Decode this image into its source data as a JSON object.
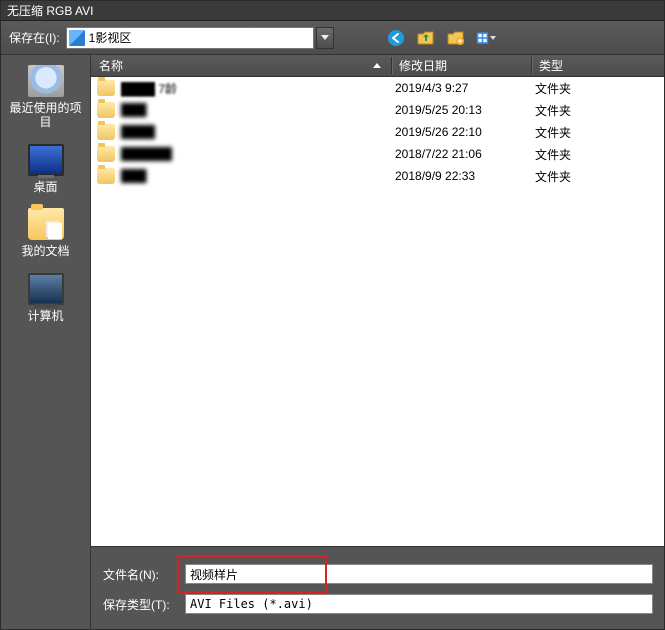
{
  "title": "无压缩 RGB AVI",
  "toolbar": {
    "save_in_label": "保存在(I):",
    "location_text": "1影视区"
  },
  "places": [
    {
      "id": "recent",
      "label": "最近使用的项目"
    },
    {
      "id": "desktop",
      "label": "桌面"
    },
    {
      "id": "docs",
      "label": "我的文档"
    },
    {
      "id": "computer",
      "label": "计算机"
    }
  ],
  "columns": {
    "name": "名称",
    "date": "修改日期",
    "type": "类型"
  },
  "folder_type": "文件夹",
  "rows": [
    {
      "name": "████ 7龄",
      "date": "2019/4/3 9:27"
    },
    {
      "name": "███",
      "date": "2019/5/25 20:13"
    },
    {
      "name": "████",
      "date": "2019/5/26 22:10"
    },
    {
      "name": "██████",
      "date": "2018/7/22 21:06"
    },
    {
      "name": "███",
      "date": "2018/9/9 22:33"
    }
  ],
  "bottom": {
    "filename_label": "文件名(N):",
    "filename_value": "视频样片",
    "filetype_label": "保存类型(T):",
    "filetype_value": "AVI Files (*.avi)"
  }
}
